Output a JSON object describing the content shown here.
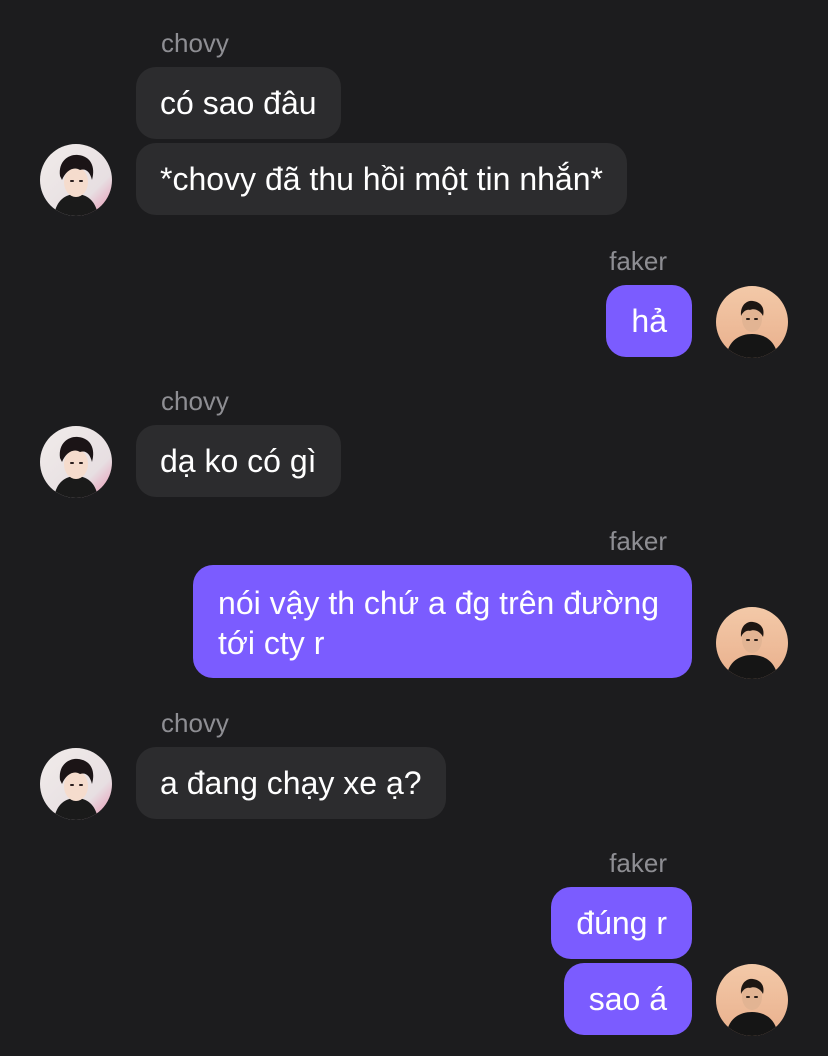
{
  "messages": [
    {
      "sender": "chovy",
      "text": "có sao đâu"
    },
    {
      "sender": "chovy",
      "text": "*chovy đã thu hồi một tin nhắn*"
    },
    {
      "sender": "faker",
      "text": "hả"
    },
    {
      "sender": "chovy",
      "text": "dạ ko có gì"
    },
    {
      "sender": "faker",
      "text": "nói vậy th chứ a đg trên đường",
      "text_line2": "tới cty r"
    },
    {
      "sender": "chovy",
      "text": "a đang chạy xe ạ?"
    },
    {
      "sender": "faker",
      "text": "đúng r"
    },
    {
      "sender": "faker",
      "text": "sao á"
    }
  ],
  "icons": {
    "chovy_avatar": "avatar-chovy-icon",
    "faker_avatar": "avatar-faker-icon"
  },
  "colors": {
    "background": "#1c1c1e",
    "incoming_bubble": "#2c2c2e",
    "outgoing_bubble": "#7b5cff",
    "sender_name": "#8e8e93"
  }
}
